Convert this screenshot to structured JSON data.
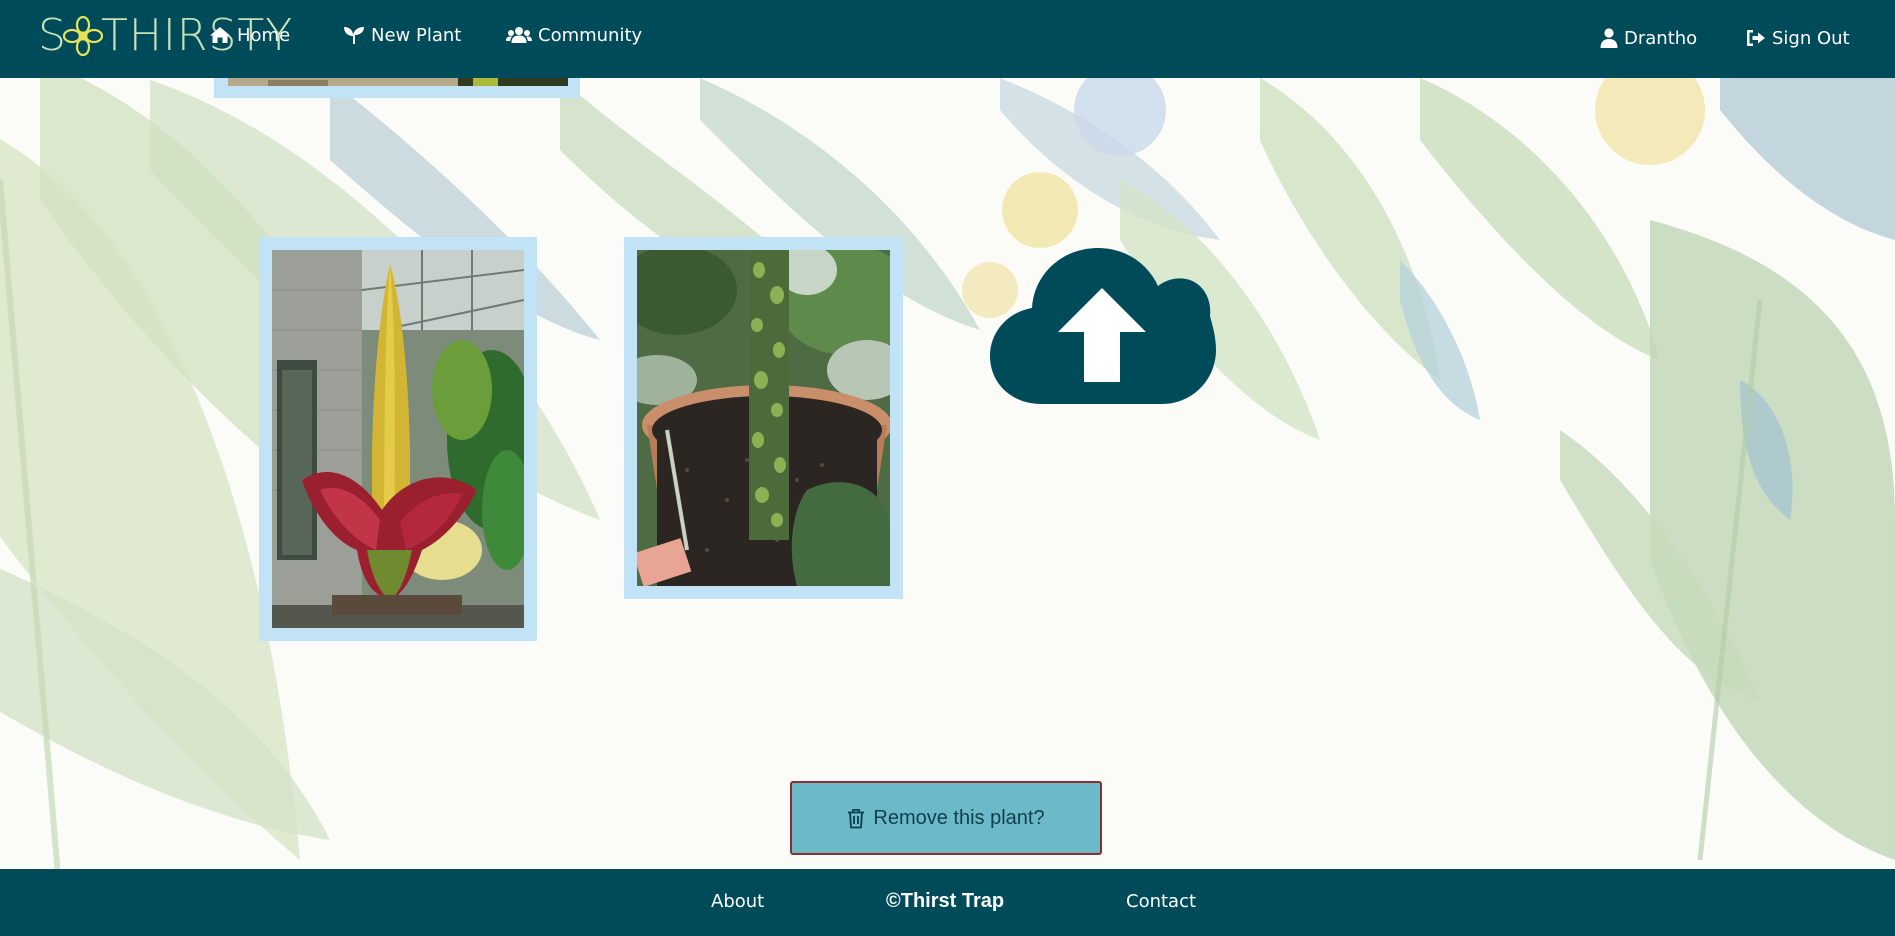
{
  "brand": {
    "name_left": "S",
    "name_right": "THIRSTY"
  },
  "nav": {
    "home": "Home",
    "new_plant": "New Plant",
    "community": "Community",
    "user": "Drantho",
    "sign_out": "Sign Out"
  },
  "actions": {
    "remove": "Remove this plant?"
  },
  "footer": {
    "about": "About",
    "copyright": "©Thirst Trap",
    "contact": "Contact"
  },
  "icons": [
    "home-icon",
    "seedling-icon",
    "users-icon",
    "user-icon",
    "sign-out-icon",
    "cloud-upload-icon",
    "trash-icon"
  ],
  "colors": {
    "navbar": "#004b5a",
    "card_frame": "#c2e2f6",
    "remove_button": "#6cbac9",
    "remove_border": "#8a2f2f",
    "brand_text": "#c6e0b9",
    "flower": "#e6e35a"
  }
}
